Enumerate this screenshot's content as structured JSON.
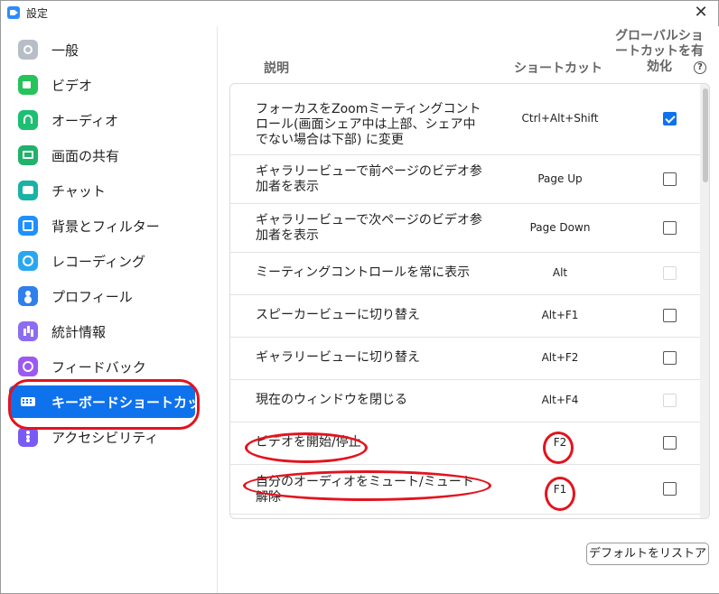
{
  "window": {
    "title": "設定"
  },
  "sidebar": {
    "items": [
      {
        "label": "一般",
        "icon": "gear-icon",
        "active": false
      },
      {
        "label": "ビデオ",
        "icon": "video-icon",
        "active": false
      },
      {
        "label": "オーディオ",
        "icon": "headphones-icon",
        "active": false
      },
      {
        "label": "画面の共有",
        "icon": "share-screen-icon",
        "active": false
      },
      {
        "label": "チャット",
        "icon": "chat-icon",
        "active": false
      },
      {
        "label": "背景とフィルター",
        "icon": "background-icon",
        "active": false
      },
      {
        "label": "レコーディング",
        "icon": "record-icon",
        "active": false
      },
      {
        "label": "プロフィール",
        "icon": "profile-icon",
        "active": false
      },
      {
        "label": "統計情報",
        "icon": "stats-icon",
        "active": false
      },
      {
        "label": "フィードバック",
        "icon": "feedback-icon",
        "active": false
      },
      {
        "label": "キーボードショートカット",
        "icon": "keyboard-icon",
        "active": true
      },
      {
        "label": "アクセシビリティ",
        "icon": "accessibility-icon",
        "active": false
      }
    ]
  },
  "main": {
    "header": {
      "description": "説明",
      "shortcut": "ショートカット",
      "enable_global": "グローバルショートカットを有効化",
      "help": "?"
    },
    "rows": [
      {
        "description": "フォーカスをZoomミーティングコントロール(画面シェア中は上部、シェア中でない場合は下部) に変更",
        "shortcut": "Ctrl+Alt+Shift",
        "global": "checked"
      },
      {
        "description": "ギャラリービューで前ページのビデオ参加者を表示",
        "shortcut": "Page Up",
        "global": "unchecked"
      },
      {
        "description": "ギャラリービューで次ページのビデオ参加者を表示",
        "shortcut": "Page Down",
        "global": "unchecked"
      },
      {
        "description": "ミーティングコントロールを常に表示",
        "shortcut": "Alt",
        "global": "disabled"
      },
      {
        "description": "スピーカービューに切り替え",
        "shortcut": "Alt+F1",
        "global": "unchecked"
      },
      {
        "description": "ギャラリービューに切り替え",
        "shortcut": "Alt+F2",
        "global": "unchecked"
      },
      {
        "description": "現在のウィンドウを閉じる",
        "shortcut": "Alt+F4",
        "global": "disabled"
      },
      {
        "description": "ビデオを開始/停止",
        "shortcut": "F2",
        "global": "unchecked"
      },
      {
        "description": "自分のオーディオをミュート/ミュート解除",
        "shortcut": "F1",
        "global": "unchecked"
      }
    ],
    "restore_button": "デフォルトをリストア"
  },
  "colors": {
    "accent": "#0e72ed",
    "annotation": "#e3131e"
  }
}
